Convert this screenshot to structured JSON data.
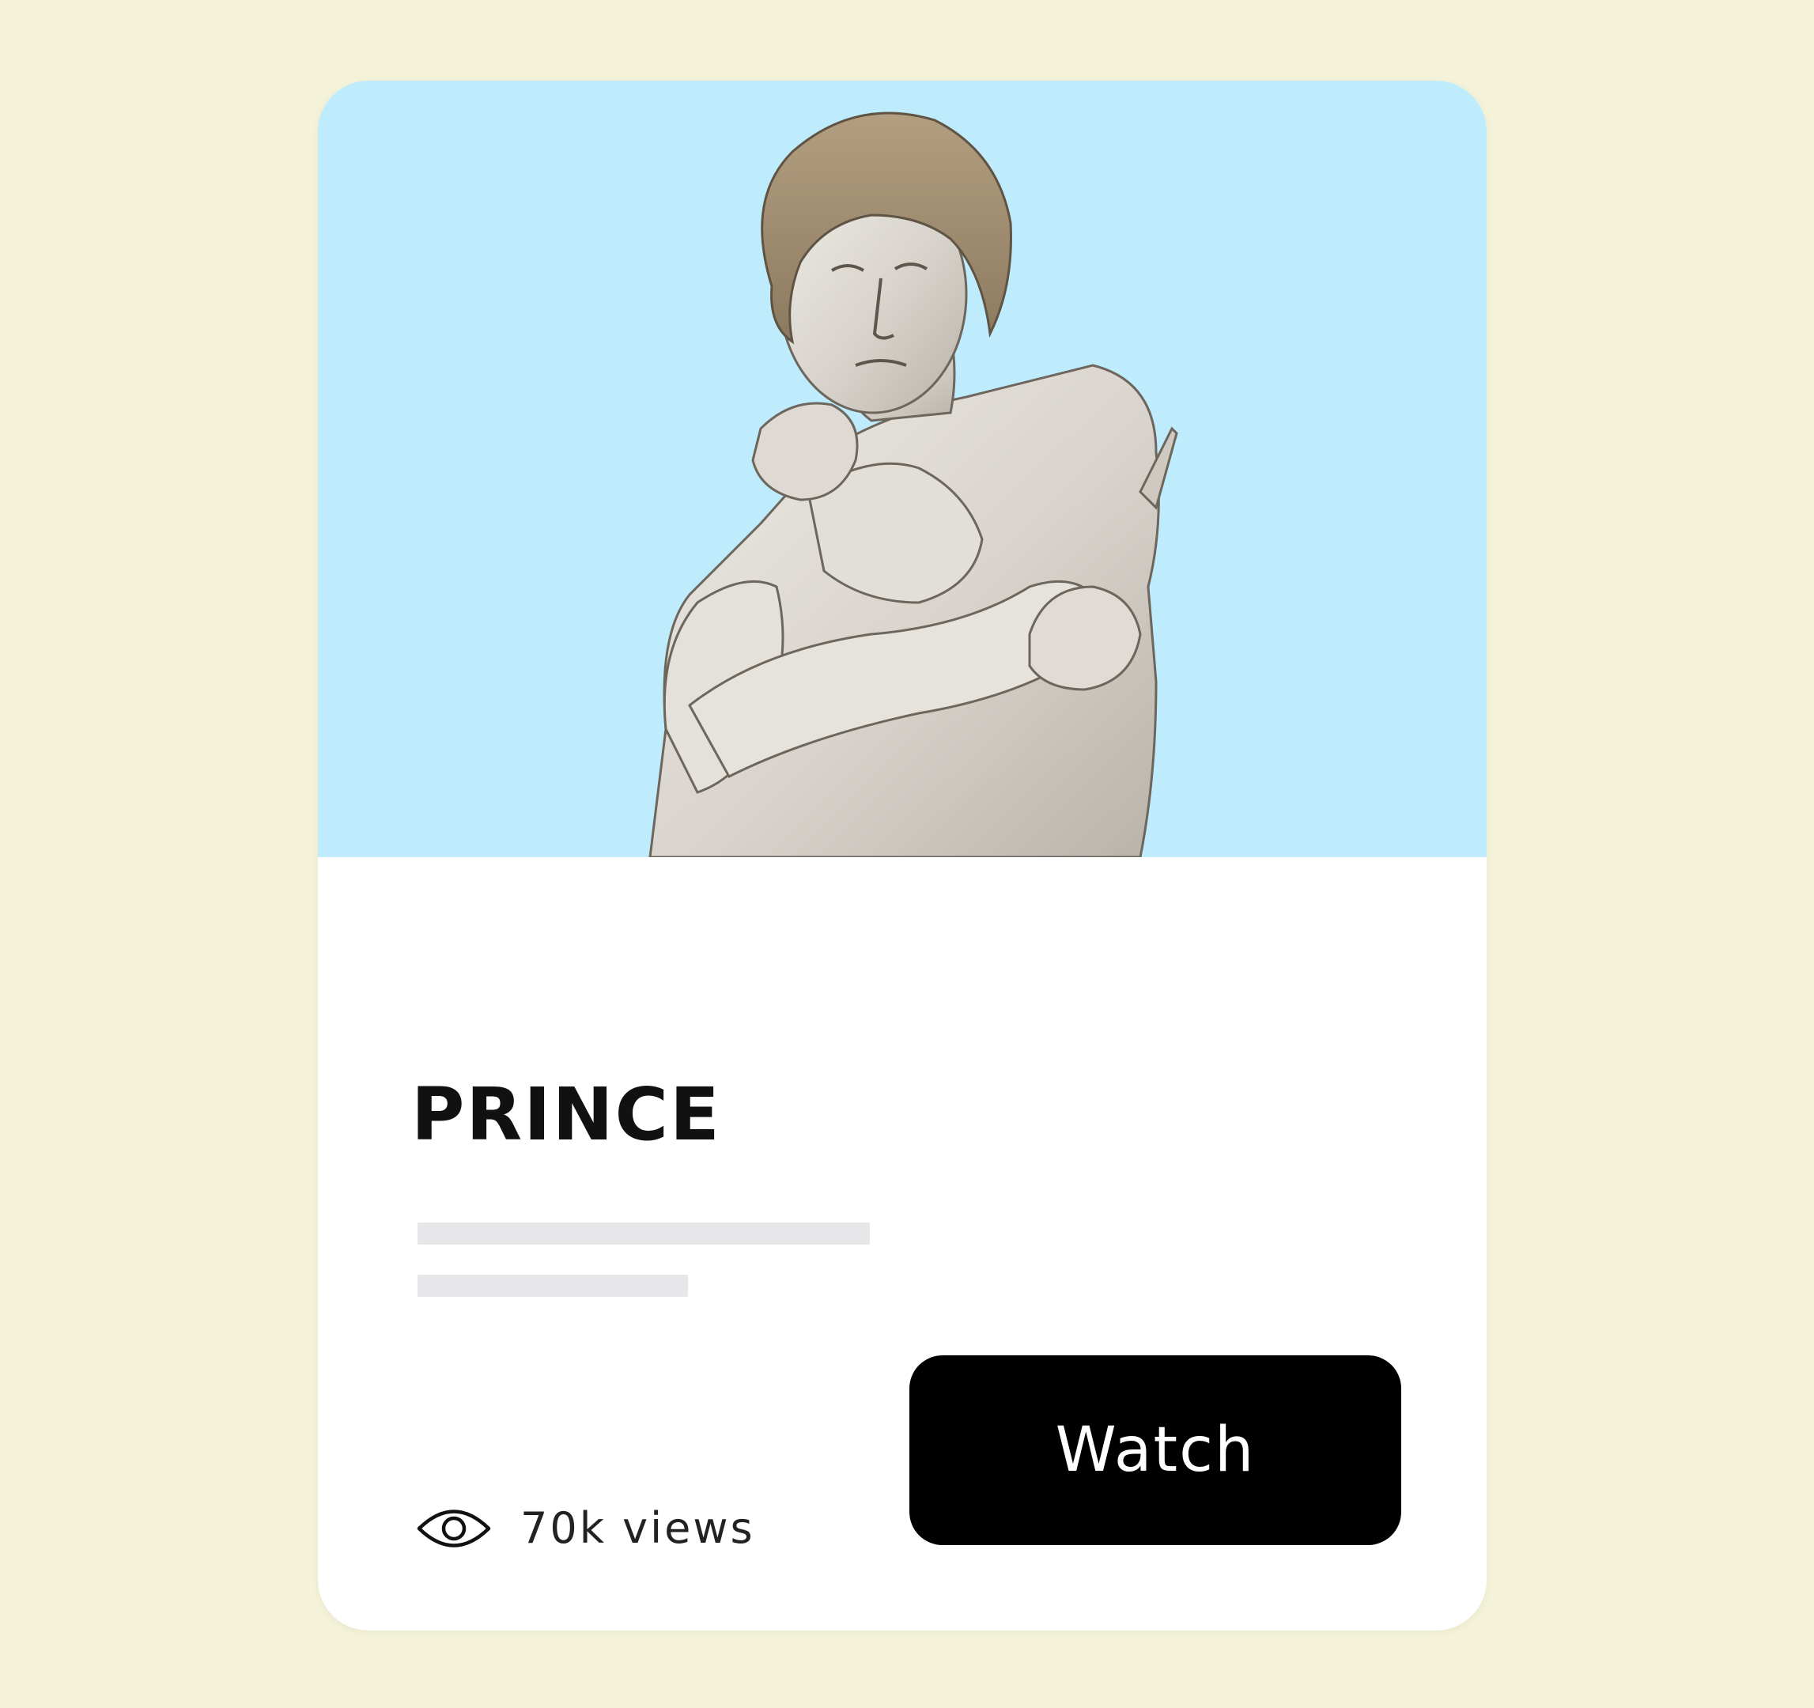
{
  "page": {
    "background": "#f4f3da"
  },
  "card": {
    "image": {
      "subject": "marble-statue",
      "background": "#bfecfc"
    },
    "title": "PRINCE",
    "skeleton_lines": 2,
    "views": {
      "icon": "eye-icon",
      "text": "70k views"
    },
    "watch_button": {
      "label": "Watch",
      "background": "#000000",
      "color": "#ffffff"
    }
  }
}
